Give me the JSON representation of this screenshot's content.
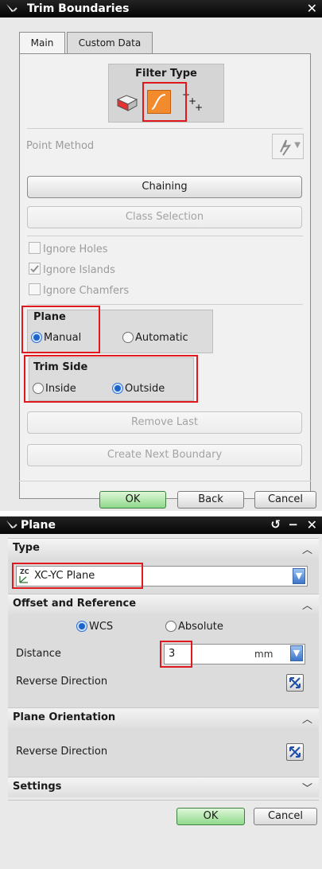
{
  "trim_dialog": {
    "title": "Trim Boundaries",
    "tabs": [
      {
        "label": "Main"
      },
      {
        "label": "Custom Data"
      }
    ],
    "filter_type_label": "Filter Type",
    "point_method_label": "Point Method",
    "chaining_label": "Chaining",
    "class_selection_label": "Class Selection",
    "options": [
      {
        "label": "Ignore Holes",
        "checked": false
      },
      {
        "label": "Ignore Islands",
        "checked": true
      },
      {
        "label": "Ignore Chamfers",
        "checked": false
      }
    ],
    "plane": {
      "title": "Plane",
      "manual": "Manual",
      "automatic": "Automatic",
      "selected": "Manual"
    },
    "trim_side": {
      "title": "Trim Side",
      "inside": "Inside",
      "outside": "Outside",
      "selected": "Outside"
    },
    "remove_last_label": "Remove Last",
    "create_next_label": "Create Next Boundary",
    "buttons": {
      "ok": "OK",
      "back": "Back",
      "cancel": "Cancel"
    }
  },
  "plane_dialog": {
    "title": "Plane",
    "type_section": "Type",
    "type_icon_text": "ZC",
    "type_value": "XC-YC Plane",
    "offset_section": "Offset and Reference",
    "wcs_label": "WCS",
    "absolute_label": "Absolute",
    "distance_label": "Distance",
    "distance_value": "3",
    "unit": "mm",
    "reverse_direction_label": "Reverse Direction",
    "orientation_section": "Plane Orientation",
    "orientation_reverse_label": "Reverse Direction",
    "settings_section": "Settings",
    "buttons": {
      "ok": "OK",
      "cancel": "Cancel"
    }
  },
  "colors": {
    "highlight_red": "#e0191f",
    "radio_blue": "#1d64c8",
    "ok_green": "#8fd98a",
    "title_bar": "#0a0a0a"
  }
}
